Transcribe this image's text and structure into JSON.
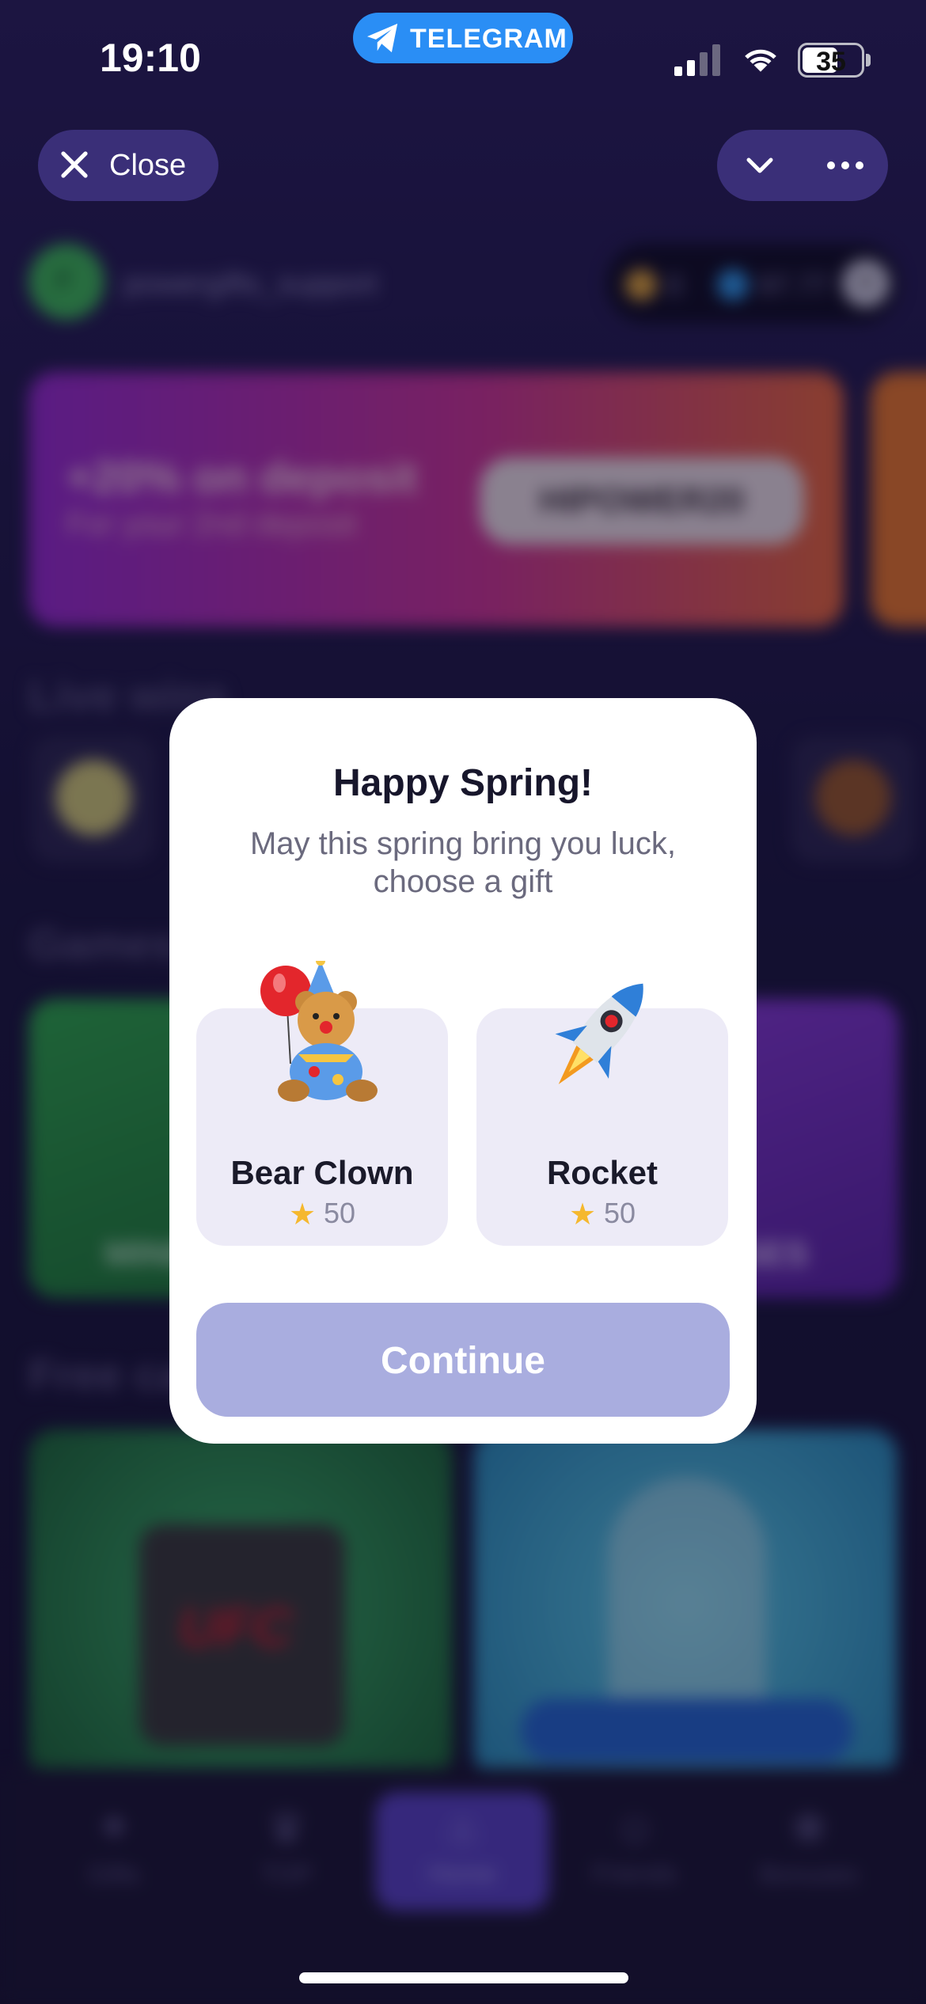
{
  "status_bar": {
    "time": "19:10",
    "telegram_label": "TELEGRAM",
    "battery": "35"
  },
  "header": {
    "close_label": "Close"
  },
  "background": {
    "username": "powergifts_support",
    "balance_stars": "0",
    "balance_ton": "97.77",
    "promo_title": "+20% on deposit",
    "promo_sub": "For your 2nd deposit",
    "promo_code": "HIPOWER20",
    "live_wins_title": "Live wins",
    "games_title": "Games",
    "game_left_label": "MINES",
    "game_right_label": "CASES",
    "free_cases_title": "Free cases",
    "ufc_text": "UFC",
    "tabs": [
      {
        "label": "Gifts",
        "icon": "sparkle-icon"
      },
      {
        "label": "TOP",
        "icon": "trophy-icon"
      },
      {
        "label": "Home",
        "icon": "home-icon"
      },
      {
        "label": "Friends",
        "icon": "friends-icon"
      },
      {
        "label": "Bonuses",
        "icon": "gift-icon"
      }
    ]
  },
  "modal": {
    "title": "Happy Spring!",
    "subtitle": "May this spring bring you luck, choose a gift",
    "gifts": [
      {
        "name": "Bear Clown",
        "price": "50",
        "icon": "bear-clown-icon"
      },
      {
        "name": "Rocket",
        "price": "50",
        "icon": "rocket-icon"
      }
    ],
    "continue_label": "Continue"
  },
  "colors": {
    "telegram_blue": "#2a8ef5",
    "continue_button": "#a9addf",
    "gift_card_bg": "#edebf7",
    "star": "#f5b82e"
  }
}
